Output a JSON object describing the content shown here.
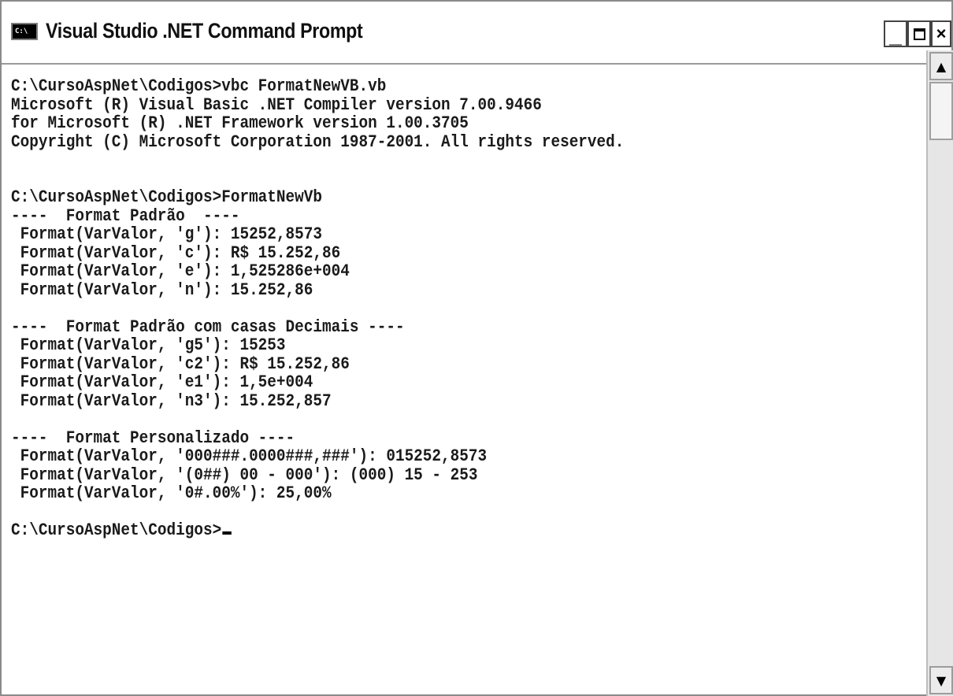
{
  "window": {
    "title": "Visual Studio .NET Command Prompt",
    "icon_label": "C:\\"
  },
  "controls": {
    "minimize_icon": "minimize-icon",
    "maximize_icon": "maximize-icon",
    "close_icon": "close-icon",
    "close_label": "×",
    "minimize_label": "_"
  },
  "console": {
    "lines": [
      "C:\\CursoAspNet\\Codigos>vbc FormatNewVB.vb",
      "Microsoft (R) Visual Basic .NET Compiler version 7.00.9466",
      "for Microsoft (R) .NET Framework version 1.00.3705",
      "Copyright (C) Microsoft Corporation 1987-2001. All rights reserved.",
      "",
      "",
      "C:\\CursoAspNet\\Codigos>FormatNewVb",
      "----  Format Padrão  ----",
      " Format(VarValor, 'g'): 15252,8573",
      " Format(VarValor, 'c'): R$ 15.252,86",
      " Format(VarValor, 'e'): 1,525286e+004",
      " Format(VarValor, 'n'): 15.252,86",
      "",
      "----  Format Padrão com casas Decimais ----",
      " Format(VarValor, 'g5'): 15253",
      " Format(VarValor, 'c2'): R$ 15.252,86",
      " Format(VarValor, 'e1'): 1,5e+004",
      " Format(VarValor, 'n3'): 15.252,857",
      "",
      "----  Format Personalizado ----",
      " Format(VarValor, '000###.0000###,###'): 015252,8573",
      " Format(VarValor, '(0##) 00 - 000'): (000) 15 - 253",
      " Format(VarValor, '0#.00%'): 25,00%",
      "",
      "C:\\CursoAspNet\\Codigos>"
    ],
    "text_color": "#1a1a1a",
    "background_color": "#ffffff"
  },
  "scrollbar": {
    "up_icon": "scroll-up-arrow-icon",
    "down_icon": "scroll-down-arrow-icon",
    "up_label": "▲",
    "down_label": "▼"
  }
}
